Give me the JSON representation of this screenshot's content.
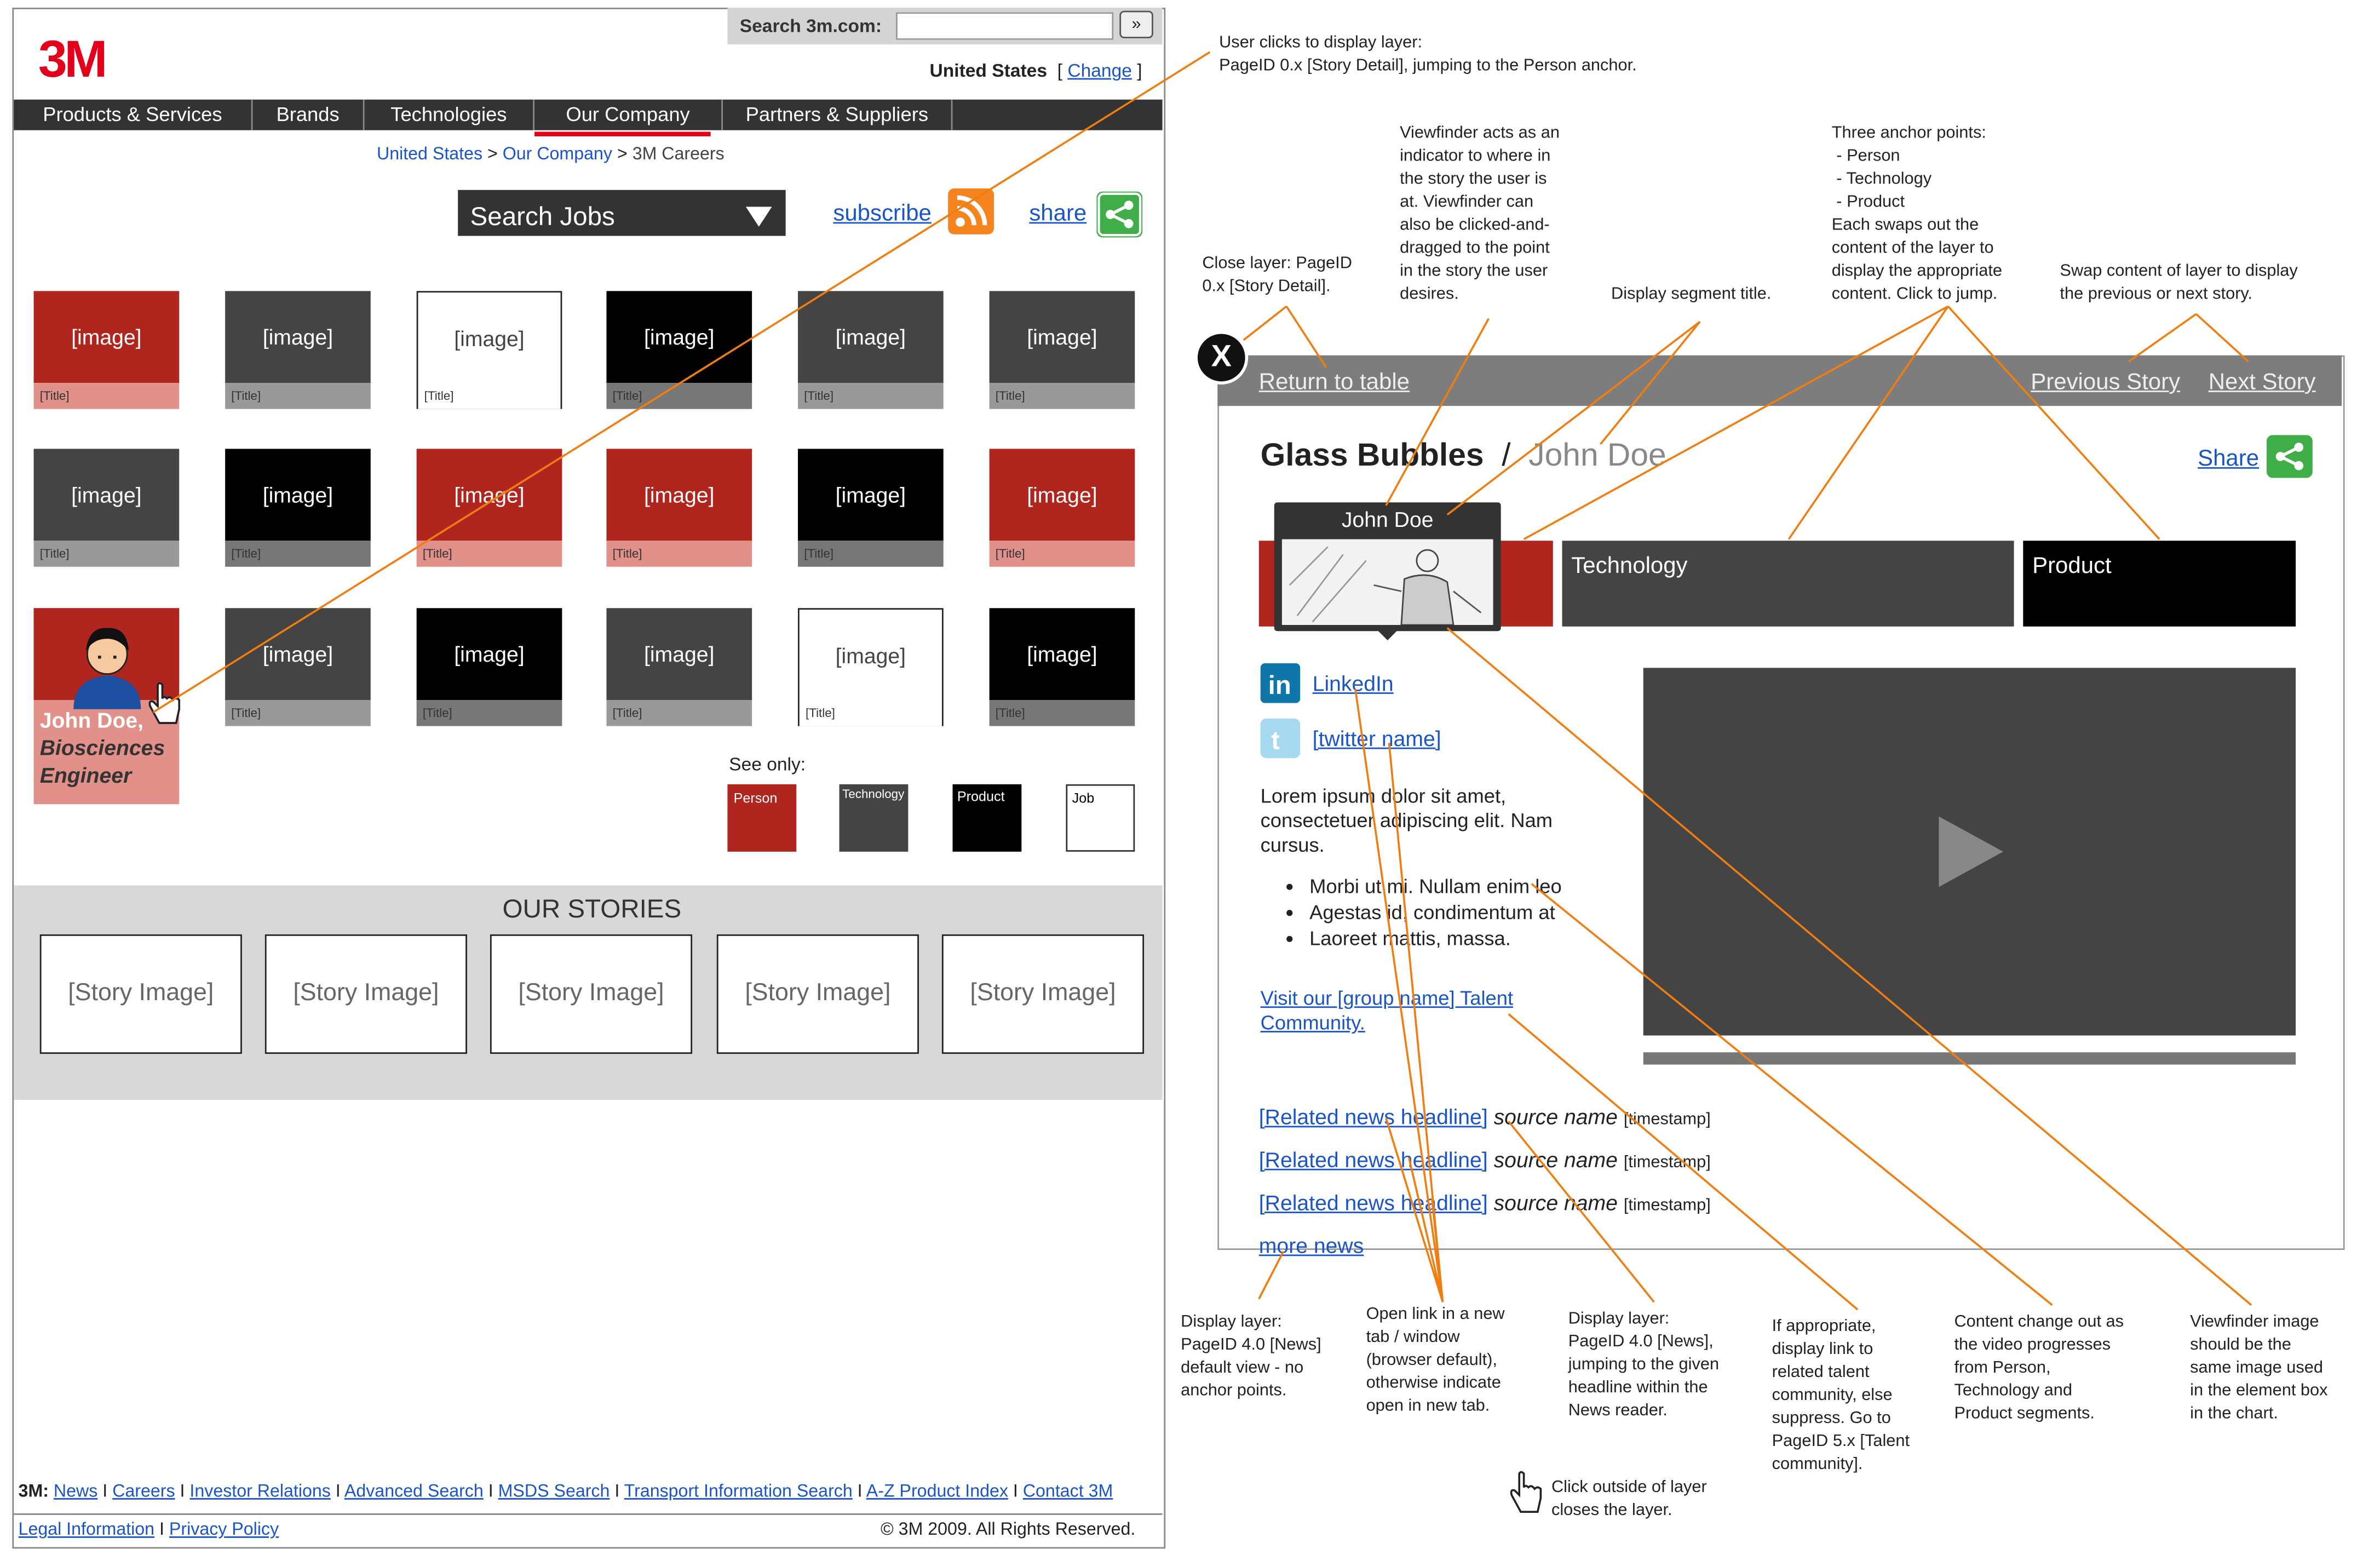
{
  "header": {
    "logo": "3M",
    "search_label": "Search 3m.com:",
    "search_go": "»",
    "country": "United States",
    "change_label": "Change"
  },
  "nav": [
    "Products & Services",
    "Brands",
    "Technologies",
    "Our Company",
    "Partners & Suppliers"
  ],
  "breadcrumb": {
    "item1": "United States",
    "item2": "Our Company",
    "current": "3M Careers",
    "sep": ">"
  },
  "toolbar": {
    "search_jobs": "Search Jobs",
    "subscribe": "subscribe",
    "share": "share"
  },
  "tiles": {
    "image_label": "[image]",
    "title_label": "[Title]",
    "rows": [
      [
        "red",
        "dark",
        "white",
        "black",
        "dark",
        "dark"
      ],
      [
        "dark",
        "black",
        "red",
        "red",
        "black",
        "red"
      ],
      [
        "person",
        "dark",
        "black",
        "dark",
        "white",
        "black"
      ]
    ],
    "person_caption": [
      "John Doe,",
      "Biosciences",
      "Engineer"
    ]
  },
  "filters": {
    "label": "See only:",
    "items": [
      "Person",
      "Technology",
      "Product",
      "Job"
    ]
  },
  "stories": {
    "title": "OUR STORIES",
    "box_label": "[Story Image]"
  },
  "footer": {
    "prefix": "3M:",
    "links": [
      "News",
      "Careers",
      "Investor Relations",
      "Advanced Search",
      "MSDS Search",
      "Transport Information Search",
      "A-Z Product Index",
      "Contact 3M"
    ],
    "legal": "Legal Information",
    "privacy": "Privacy Policy",
    "copyright": "© 3M 2009. All Rights Reserved."
  },
  "layer": {
    "close": "X",
    "return": "Return to table",
    "prev": "Previous Story",
    "next": "Next Story",
    "title": "Glass Bubbles",
    "subtitle": "John Doe",
    "share": "Share",
    "viewfinder_name": "John Doe",
    "segments": [
      "Technology",
      "Product"
    ],
    "linkedin": "LinkedIn",
    "twitter": "[twitter name]",
    "body": "Lorem ipsum dolor sit amet, consectetuer adipiscing elit. Nam cursus.",
    "bullets": [
      "Morbi ut mi. Nullam enim leo",
      "Agestas id, condimentum at",
      "Laoreet mattis, massa."
    ],
    "talent_link": "Visit our [group name] Talent Community.",
    "news": [
      {
        "headline": "[Related news headline]",
        "source": "source name",
        "ts": "[timestamp]"
      },
      {
        "headline": "[Related news headline]",
        "source": "source name",
        "ts": "[timestamp]"
      },
      {
        "headline": "[Related news headline]",
        "source": "source name",
        "ts": "[timestamp]"
      }
    ],
    "more_news": "more news"
  },
  "notes": {
    "n_click": "User clicks to display layer:\nPageID 0.x [Story Detail], jumping to the Person anchor.",
    "n_viewfinder": "Viewfinder acts as an\nindicator to where in\nthe story the user is\nat. Viewfinder can\nalso be clicked-and-\ndragged to the point\nin the story the user\ndesires.",
    "n_anchors": "Three anchor points:\n - Person\n - Technology\n - Product\nEach swaps out the\ncontent of the layer to\ndisplay the appropriate\ncontent. Click to jump.",
    "n_close": "Close layer: PageID\n0.x [Story Detail].",
    "n_segment": "Display segment title.",
    "n_swap": "Swap content of layer to display\nthe previous or next story.",
    "n_news": "Display layer:\nPageID 4.0 [News]\ndefault view - no\nanchor points.",
    "n_newtab": "Open link in a new\ntab / window\n(browser default),\notherwise indicate\nopen in new tab.",
    "n_headline": "Display layer:\nPageID 4.0 [News],\njumping to the given\nheadline within the\nNews reader.",
    "n_talent": "If appropriate,\ndisplay link to\nrelated talent\ncommunity, else\nsuppress. Go to\nPageID 5.x [Talent\ncommunity].",
    "n_content": "Content change out as\nthe video progresses\nfrom Person,\nTechnology and\nProduct segments.",
    "n_vfimage": "Viewfinder image\nshould be the\nsame image used\nin the element box\nin the chart.",
    "n_outside": "Click outside of layer\ncloses the layer."
  },
  "colors": {
    "red": "#b0261f",
    "annotation": "#f07d10",
    "brand": "#e2001a"
  }
}
